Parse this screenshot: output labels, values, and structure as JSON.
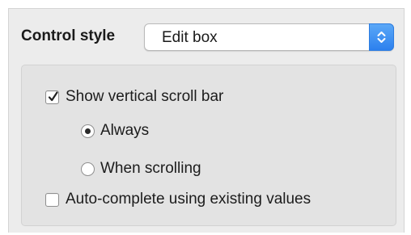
{
  "control_style": {
    "label": "Control style",
    "selected_value": "Edit box"
  },
  "options": {
    "show_vertical_scroll_bar": {
      "label": "Show vertical scroll bar",
      "checked": true
    },
    "scroll_bar_mode": {
      "selected": "always",
      "items": [
        {
          "id": "always",
          "label": "Always"
        },
        {
          "id": "when_scrolling",
          "label": "When scrolling"
        }
      ]
    },
    "auto_complete": {
      "label": "Auto-complete using existing values",
      "checked": false
    }
  },
  "colors": {
    "accent": "#2c80ee",
    "panel_bg": "#ececec",
    "group_bg": "#e3e3e3"
  }
}
